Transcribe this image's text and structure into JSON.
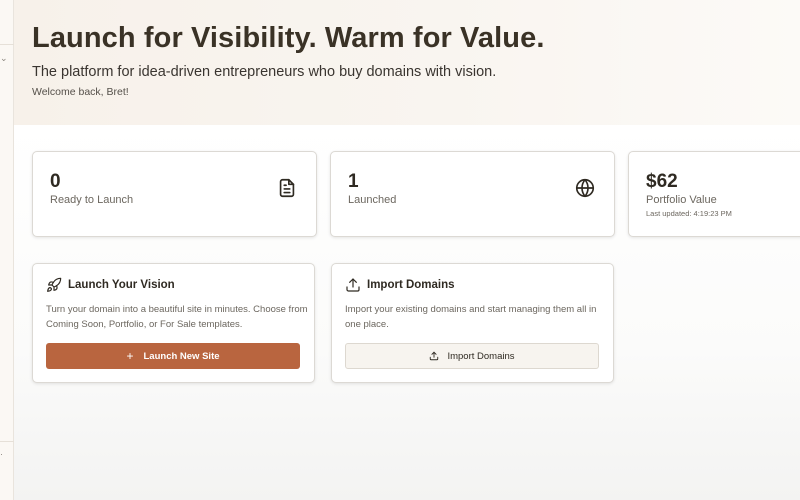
{
  "hero": {
    "title": "Launch for Visibility. Warm for Value.",
    "subtitle": "The platform for idea-driven entrepreneurs who buy domains with vision.",
    "welcome": "Welcome back, Bret!"
  },
  "stats": [
    {
      "value": "0",
      "label": "Ready to Launch",
      "icon": "document-icon"
    },
    {
      "value": "1",
      "label": "Launched",
      "icon": "globe-icon"
    },
    {
      "value": "$62",
      "label": "Portfolio Value",
      "updated": "Last updated: 4:19:23 PM"
    }
  ],
  "cards": {
    "launch": {
      "title": "Launch Your Vision",
      "description": "Turn your domain into a beautiful site in minutes. Choose from Coming Soon, Portfolio, or For Sale templates.",
      "button_label": "Launch New Site",
      "icon": "rocket-icon"
    },
    "import": {
      "title": "Import Domains",
      "description": "Import your existing domains and start managing them all in one place.",
      "button_label": "Import Domains",
      "icon": "upload-icon"
    }
  },
  "colors": {
    "accent": "#b9653f",
    "hero_bg": "#f7f1ea",
    "title_text": "#3a3226"
  }
}
